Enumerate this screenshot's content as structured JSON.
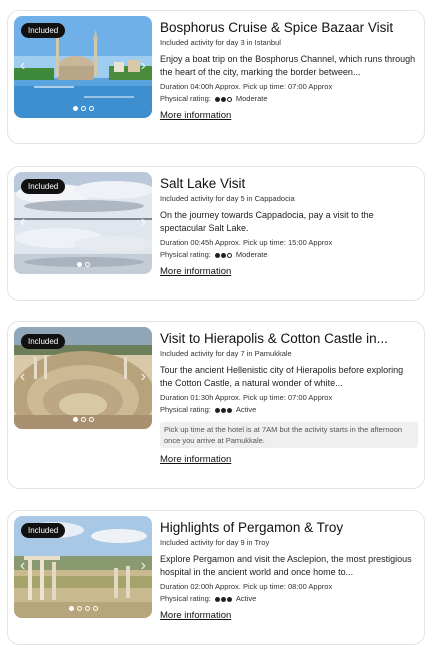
{
  "cards": [
    {
      "badge": "Included",
      "title": "Bosphorus Cruise & Spice Bazaar Visit",
      "subtitle": "Included activity for day 3 in Istanbul",
      "description": "Enjoy a boat trip on the Bosphorus Channel, which runs through the heart of the city, marking the border between...",
      "details": "Duration 04:00h Approx. Pick up time: 07:00 Approx",
      "rating_label": "Physical rating:",
      "rating_text": "Moderate",
      "rating_level": 2,
      "rating_max": 3,
      "link": "More information",
      "image_count": 3,
      "image_active": 1
    },
    {
      "badge": "Included",
      "title": "Salt Lake Visit",
      "subtitle": "Included activity for day 5 in Cappadocia",
      "description": "On the journey towards Cappadocia, pay a visit to the spectacular Salt Lake.",
      "details": "Duration 00:45h Approx. Pick up time: 15:00 Approx",
      "rating_label": "Physical rating:",
      "rating_text": "Moderate",
      "rating_level": 2,
      "rating_max": 3,
      "link": "More information",
      "image_count": 2,
      "image_active": 1
    },
    {
      "badge": "Included",
      "title": "Visit to Hierapolis & Cotton Castle in...",
      "subtitle": "Included activity for day 7 in Pamukkale",
      "description": "Tour the ancient Hellenistic city of Hierapolis before exploring the Cotton Castle, a natural wonder of white...",
      "details": "Duration 01:30h Approx. Pick up time: 07:00 Approx",
      "rating_label": "Physical rating:",
      "rating_text": "Active",
      "rating_level": 3,
      "rating_max": 3,
      "note": "Pick up time at the hotel is at 7AM but the activity starts in the afternoon once you arrive at Pamukkale.",
      "link": "More information",
      "image_count": 3,
      "image_active": 1
    },
    {
      "badge": "Included",
      "title": "Highlights of Pergamon & Troy",
      "subtitle": "Included activity for day 9 in Troy",
      "description": "Explore Pergamon and visit the Asclepion, the most prestigious hospital in the ancient world and once home to...",
      "details": "Duration 02:00h Approx. Pick up time: 08:00 Approx",
      "rating_label": "Physical rating:",
      "rating_text": "Active",
      "rating_level": 3,
      "rating_max": 3,
      "link": "More information",
      "image_count": 4,
      "image_active": 1
    }
  ],
  "icons": {
    "prev": "chevron-left-icon",
    "next": "chevron-right-icon"
  }
}
